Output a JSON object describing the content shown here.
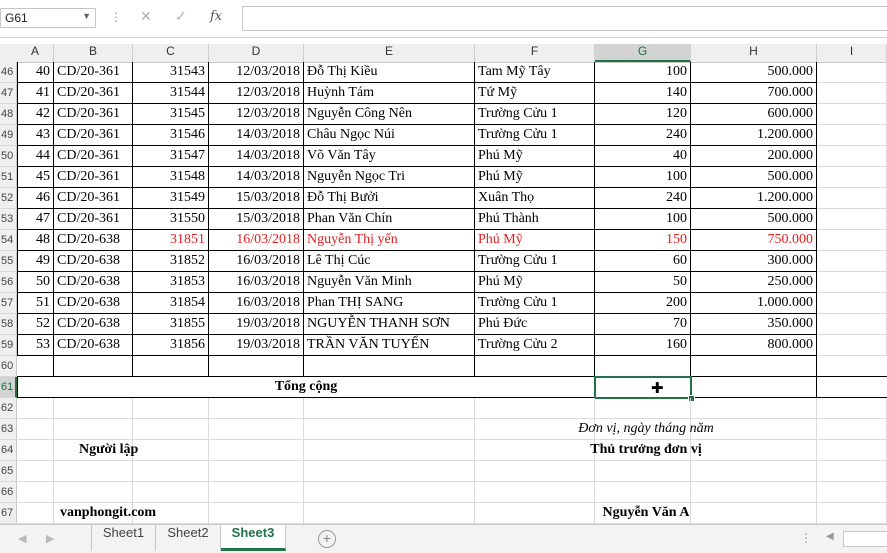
{
  "formula_bar": {
    "name_box": "G61",
    "formula": ""
  },
  "columns": [
    "A",
    "B",
    "C",
    "D",
    "E",
    "F",
    "G",
    "H",
    "I"
  ],
  "rows": [
    {
      "num": "46",
      "stt": "40",
      "code": "CD/20-361",
      "id": "31543",
      "date": "12/03/2018",
      "name": "Đỗ Thị Kiều",
      "place": "Tam Mỹ Tây",
      "qty": "100",
      "amount": "500.000"
    },
    {
      "num": "47",
      "stt": "41",
      "code": "CD/20-361",
      "id": "31544",
      "date": "12/03/2018",
      "name": "Huỳnh Tám",
      "place": "Tứ Mỹ",
      "qty": "140",
      "amount": "700.000"
    },
    {
      "num": "48",
      "stt": "42",
      "code": "CD/20-361",
      "id": "31545",
      "date": "12/03/2018",
      "name": "Nguyễn Công Nên",
      "place": "Trường Cửu 1",
      "qty": "120",
      "amount": "600.000"
    },
    {
      "num": "49",
      "stt": "43",
      "code": "CD/20-361",
      "id": "31546",
      "date": "14/03/2018",
      "name": "Châu Ngọc Núi",
      "place": "Trường Cửu 1",
      "qty": "240",
      "amount": "1.200.000"
    },
    {
      "num": "50",
      "stt": "44",
      "code": "CD/20-361",
      "id": "31547",
      "date": "14/03/2018",
      "name": "Võ Văn Tây",
      "place": "Phú Mỹ",
      "qty": "40",
      "amount": "200.000"
    },
    {
      "num": "51",
      "stt": "45",
      "code": "CD/20-361",
      "id": "31548",
      "date": "14/03/2018",
      "name": "Nguyễn Ngọc Tri",
      "place": "Phú Mỹ",
      "qty": "100",
      "amount": "500.000"
    },
    {
      "num": "52",
      "stt": "46",
      "code": "CD/20-361",
      "id": "31549",
      "date": "15/03/2018",
      "name": "Đỗ Thị Bưởi",
      "place": "Xuân Thọ",
      "qty": "240",
      "amount": "1.200.000"
    },
    {
      "num": "53",
      "stt": "47",
      "code": "CD/20-361",
      "id": "31550",
      "date": "15/03/2018",
      "name": "Phan Văn Chín",
      "place": "Phú Thành",
      "qty": "100",
      "amount": "500.000"
    },
    {
      "num": "54",
      "stt": "48",
      "code": "CD/20-638",
      "id": "31851",
      "date": "16/03/2018",
      "name": "Nguyễn Thị yến",
      "place": "Phú Mỹ",
      "qty": "150",
      "amount": "750.000",
      "red": true
    },
    {
      "num": "55",
      "stt": "49",
      "code": "CD/20-638",
      "id": "31852",
      "date": "16/03/2018",
      "name": "Lê Thị Cúc",
      "place": "Trường Cửu 1",
      "qty": "60",
      "amount": "300.000"
    },
    {
      "num": "56",
      "stt": "50",
      "code": "CD/20-638",
      "id": "31853",
      "date": "16/03/2018",
      "name": "Nguyễn Văn Minh",
      "place": "Phú Mỹ",
      "qty": "50",
      "amount": "250.000"
    },
    {
      "num": "57",
      "stt": "51",
      "code": "CD/20-638",
      "id": "31854",
      "date": "16/03/2018",
      "name": "Phan THỊ SANG",
      "place": "Trường Cửu 1",
      "qty": "200",
      "amount": "1.000.000"
    },
    {
      "num": "58",
      "stt": "52",
      "code": "CD/20-638",
      "id": "31855",
      "date": "19/03/2018",
      "name": "NGUYỄN THANH SƠN",
      "place": "Phú Đức",
      "qty": "70",
      "amount": "350.000"
    },
    {
      "num": "59",
      "stt": "53",
      "code": "CD/20-638",
      "id": "31856",
      "date": "19/03/2018",
      "name": "TRẦN VĂN TUYỂN",
      "place": "Trường Cửu 2",
      "qty": "160",
      "amount": "800.000"
    }
  ],
  "blank_row": "60",
  "total_row": {
    "num": "61",
    "label": "Tổng cộng"
  },
  "footer_rows": [
    "62",
    "63",
    "64",
    "65",
    "66",
    "67"
  ],
  "footer": {
    "date_line": "Đơn vị, ngày   tháng   năm",
    "preparer": "Người lập",
    "head": "Thủ trưởng đơn vị",
    "website": "vanphongit.com",
    "head_name": "Nguyễn Văn A"
  },
  "sheets": [
    "Sheet1",
    "Sheet2",
    "Sheet3"
  ],
  "active_sheet": "Sheet3",
  "colors": {
    "accent": "#217346",
    "highlight": "#e02020"
  }
}
